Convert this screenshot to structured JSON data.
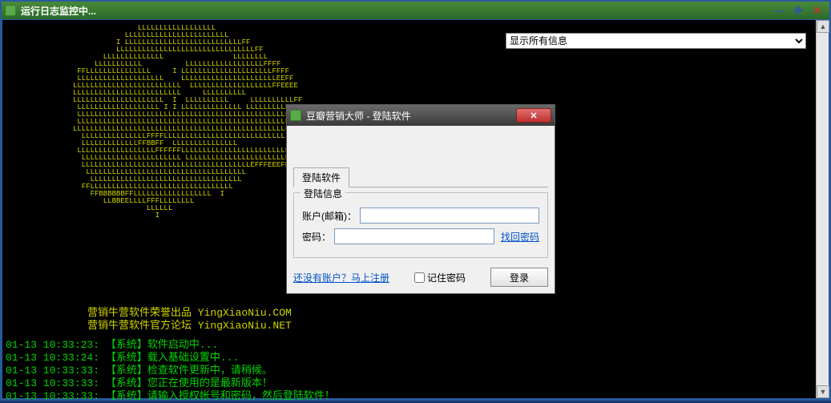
{
  "window": {
    "title": "运行日志监控中..."
  },
  "filter": {
    "selected": "显示所有信息"
  },
  "ascii": "               LLLLLLLLLLLLLLLLLL\n            LLLLLLLLLLLLLLLLLLLLLLLL\n          I LLLLLLLLLLLLLLLLLLLLLLLLLLLFF\n          LLLLLLLLLLLLLLLLLLLLLLLLLLLLLLLLFF\n       LLLLLLLLLLLLLL                LLLLLLLL\n     LLLLLLLLLLL          LLLLLLLLLLLLLLLLLLFFFF\n FFLLLLLLLLLLLLLLL     I LLLLLLLLLLLLLLLLLLLLLFFFF\n LLLLLLLLLLLLLLLLLLLL    LLLLLLLLLLLLLLLLLLLLLLEEFF\nLLLLLLLLLLLLLLLLLLLLLLLLL  LLLLLLLLLLLLLLLLLLLFFEEEE\nLLLLLLLLLLLLLLLLLLLLLLLLL     LLLLLLLLLL\nLLLLLLLLLLLLLLLLLLLLL  I  LLLLLLLLLL     LLLLLLLLLLFF\n LLLLLLLLLLLLLLLLLLL I I LLLLLLLLLLLLLL LLLLLLLLLL\n LLLLLLLLLLLLLLLLLLLLLLLLLLLLLLLLLLLLLLLLLLLLLLLLLL\n LLLLLLLLLLLLLLLLLLLLLLLLLLLLLLLLLLLLLLLLLLLLLLLLLL\nLLLLLLLLLLLLLLLLLLLLLLLLLLLLLLLLLLLLLLLLLLLLLLLLLLL\n  LLLLLLLLLLLLLLLFFFFLLLLLLLLLLLLLLLLLLLLLLLLLLLL\n  LLLLLLLLLLLLLFFBBFF  LLLLLLLLLLLLLLL\n LLLLLLLLLLLLLLLLLLFFFFFFLLLLLLLLLLLLLLLLLLLLLLLLL\n  LLLLLLLLLLLLLLLLLLLLLLL LLLLLLLLLLLLLLLLLLLLLLLL\n  LLLLLLLLLLLLLLLLLLLLLLLLLLLLLLLLLLLLLLLEFFFEEEFF\n   LLLLLLLLLLLLLLLLLLLLLLLLLLLLLLLLLLLLL\n    LLLLLLLLLLLLLLLLLLLLLLLLLLLLLLLLLLL\n  FFLLLLLLLLLLLLLLLLLLLLLLLLLLLLLLLLL\n    FFBBBBBBFFLLLLLLLLLLLLLLLLLL  I\n       LLBBEELLLLFFFLLLLLLLL\n                 LLLLLL\n                   I",
  "credits": {
    "line1": "营销牛营软件荣誉出品 YingXiaoNiu.COM",
    "line2": "营销牛营软件官方论坛 YingXiaoNiu.NET"
  },
  "logs": [
    "01-13 10:33:23: 【系统】软件启动中...",
    "01-13 10:33:24: 【系统】载入基础设置中...",
    "01-13 10:33:33: 【系统】检查软件更新中，请稍候。",
    "01-13 10:33:33: 【系统】您正在使用的是最新版本！",
    "01-13 10:33:33: 【系统】请输入授权帐号和密码，然后登陆软件！"
  ],
  "dialog": {
    "title": "豆瓣营销大师 - 登陆软件",
    "tab": "登陆软件",
    "group": "登陆信息",
    "account_label": "账户(邮箱)：",
    "account_value": "",
    "password_label": "密码：",
    "password_value": "",
    "forgot": "找回密码",
    "register": "还没有账户？马上注册",
    "remember": "记住密码",
    "login_btn": "登录"
  }
}
